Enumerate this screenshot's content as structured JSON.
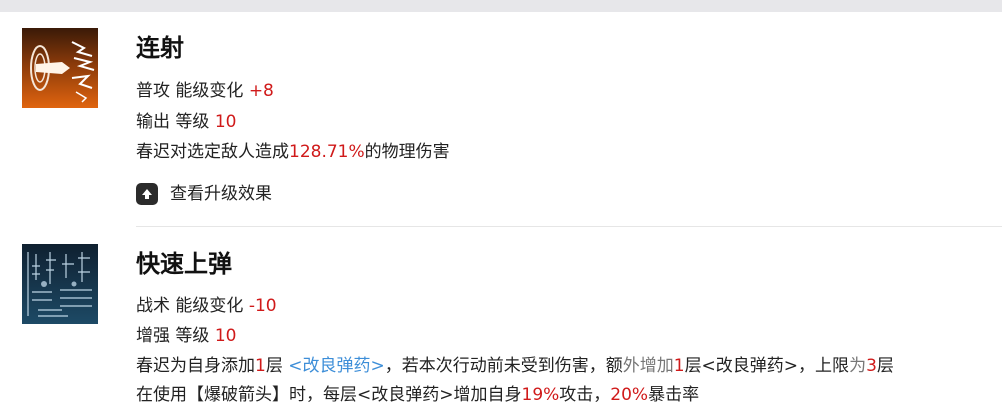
{
  "skills": [
    {
      "icon": "rapid-fire-skill-icon",
      "name": "连射",
      "type_line": {
        "prefix": "普攻 能级变化 ",
        "value": "+8"
      },
      "level_line": {
        "prefix": "输出 等级 ",
        "value": "10"
      },
      "desc": {
        "a": "春迟对选定敌人造成",
        "b": "128.71%",
        "c": "的物理伤害"
      },
      "upgrade_label": "查看升级效果"
    },
    {
      "icon": "quick-reload-skill-icon",
      "name": "快速上弹",
      "type_line": {
        "prefix": "战术 能级变化 ",
        "value": "-10"
      },
      "level_line": {
        "prefix": "增强 等级 ",
        "value": "10"
      },
      "desc1": {
        "a": "春迟为自身添加",
        "b": "1",
        "c": "层 ",
        "d": "<改良弹药>",
        "e": "，若本次行动前未受到伤害，额",
        "f": "外增加",
        "g": "1",
        "h": "层<改良弹药>，上限",
        "i": "为",
        "j": "3",
        "k": "层"
      },
      "desc2": {
        "a": "在使用【爆破箭头】时，每层<改良弹药>增加自身",
        "b": "19%",
        "c": "攻击，",
        "d": "20%",
        "e": "暴击率"
      }
    }
  ],
  "colors": {
    "highlight": "#d01a1a",
    "link": "#3d8ed8",
    "muted": "#777777"
  }
}
